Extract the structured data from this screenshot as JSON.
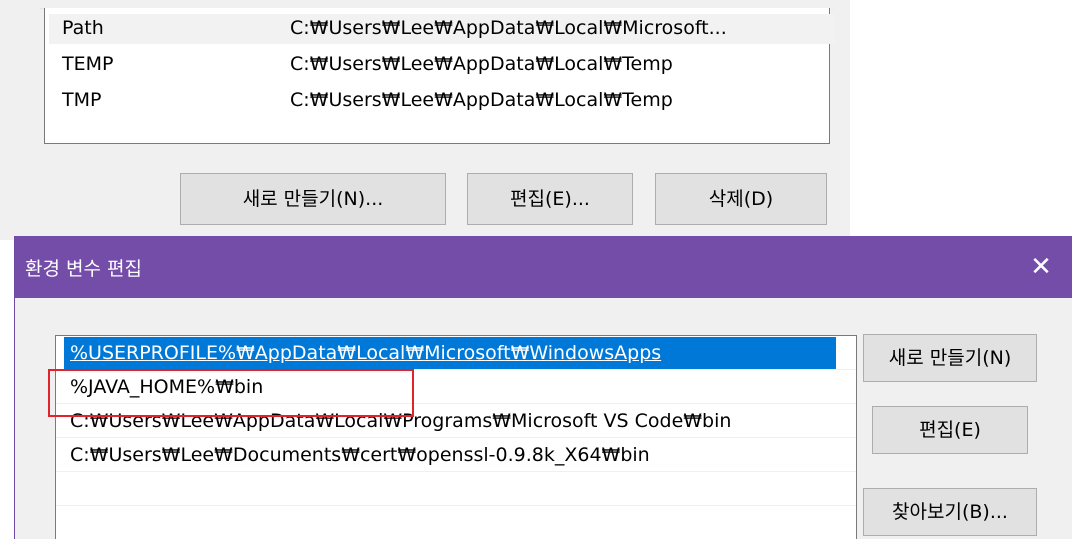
{
  "background_dialog": {
    "user_variables": [
      {
        "name": "Path",
        "value": "C:₩Users₩Lee₩AppData₩Local₩Microsoft..."
      },
      {
        "name": "TEMP",
        "value": "C:₩Users₩Lee₩AppData₩Local₩Temp"
      },
      {
        "name": "TMP",
        "value": "C:₩Users₩Lee₩AppData₩Local₩Temp"
      }
    ],
    "buttons": {
      "new": "새로 만들기(N)...",
      "edit": "편집(E)...",
      "delete": "삭제(D)"
    }
  },
  "edit_dialog": {
    "title": "환경 변수 편집",
    "close_glyph": "✕",
    "path_entries": [
      "%USERPROFILE%₩AppData₩Local₩Microsoft₩WindowsApps",
      "%JAVA_HOME%₩bin",
      "C:₩Users₩Lee₩AppData₩Local₩Programs₩Microsoft VS Code₩bin",
      "C:₩Users₩Lee₩Documents₩cert₩openssl-0.9.8k_X64₩bin",
      ""
    ],
    "selected_index": 0,
    "highlighted_index": 1,
    "side_buttons": {
      "new": "새로 만들기(N)",
      "edit": "편집(E)",
      "browse": "찾아보기(B)..."
    }
  },
  "colors": {
    "title_bar": "#744da9",
    "selection": "#0078d7",
    "highlight_box": "#e0242b"
  }
}
